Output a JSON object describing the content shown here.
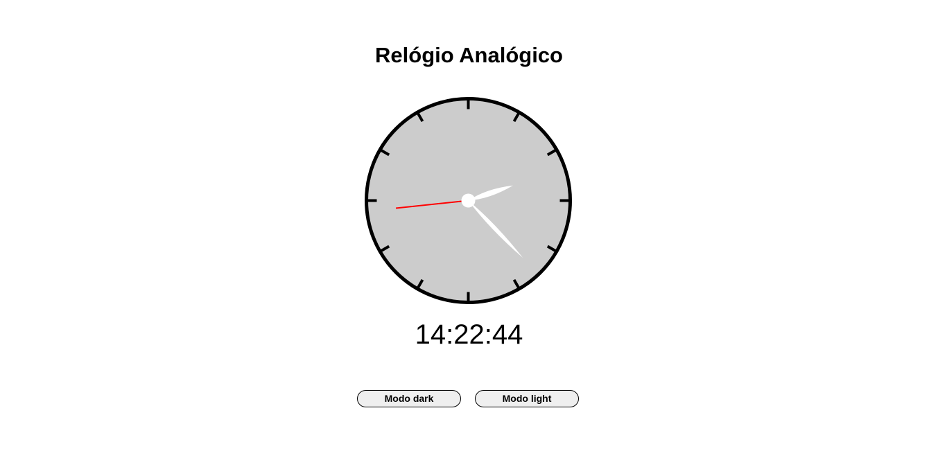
{
  "page": {
    "title": "Relógio Analógico"
  },
  "clock": {
    "time": "14:22:44",
    "hours": 14,
    "minutes": 22,
    "seconds": 44,
    "face_color": "#cccccc",
    "border_color": "#000000",
    "hand_color": "#ffffff",
    "second_hand_color": "#ff0000"
  },
  "controls": {
    "dark_label": "Modo dark",
    "light_label": "Modo light"
  }
}
